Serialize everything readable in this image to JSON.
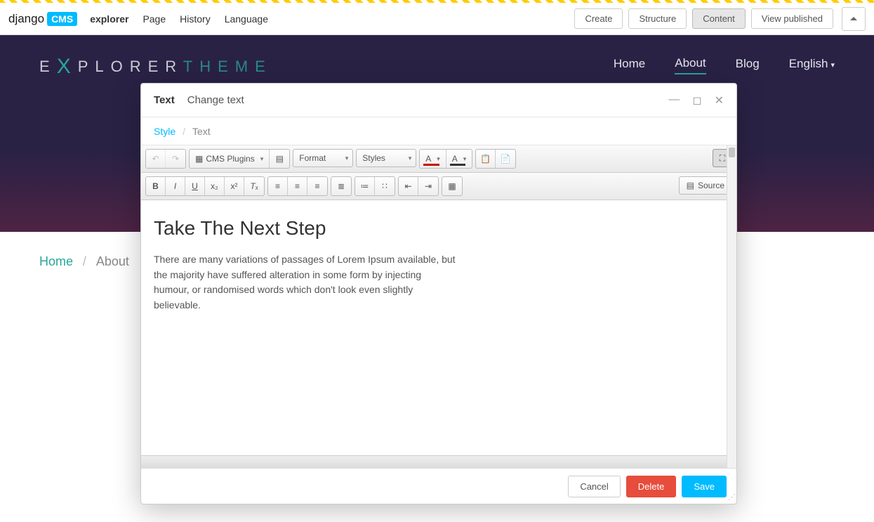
{
  "cms": {
    "logo_main": "django",
    "logo_badge": "CMS",
    "menu": [
      "explorer",
      "Page",
      "History",
      "Language"
    ],
    "buttons": {
      "create": "Create",
      "structure": "Structure",
      "content": "Content",
      "view": "View published"
    }
  },
  "site": {
    "logo_e": "E",
    "logo_x": "X",
    "logo_plorer": "PLORER",
    "logo_theme": "THEME",
    "nav": [
      "Home",
      "About",
      "Blog",
      "English"
    ],
    "nav_active": 1
  },
  "crumb": {
    "home": "Home",
    "current": "About",
    "sep": "/"
  },
  "modal": {
    "title_bold": "Text",
    "title_sub": "Change text",
    "tabs": {
      "style": "Style",
      "text": "Text",
      "sep": "/"
    },
    "toolbar": {
      "cms_plugins": "CMS Plugins",
      "format": "Format",
      "styles": "Styles",
      "source": "Source"
    },
    "content_heading": "Take The Next Step",
    "content_body": "There are many variations of passages of Lorem Ipsum available, but the majority have suffered alteration in some form by injecting humour, or randomised words which don't look even slightly believable.",
    "footer": {
      "cancel": "Cancel",
      "delete": "Delete",
      "save": "Save"
    }
  }
}
